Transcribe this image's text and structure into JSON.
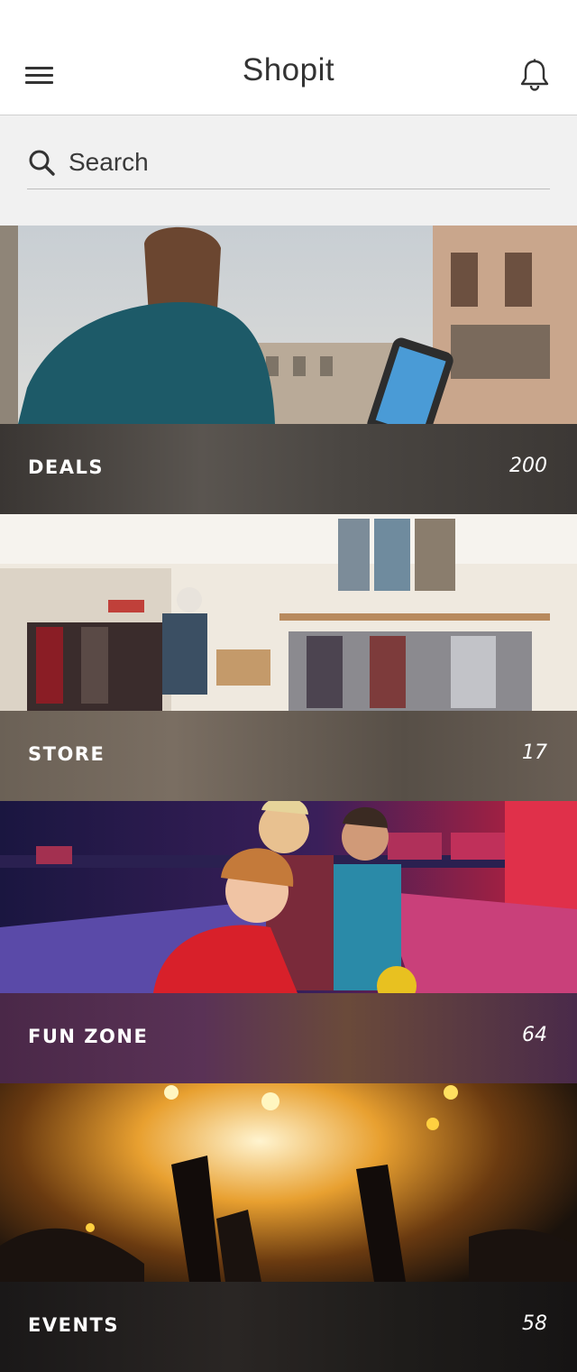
{
  "header": {
    "title": "Shopit",
    "menu_icon": "hamburger-menu-icon",
    "notification_icon": "bell-icon"
  },
  "search": {
    "placeholder": "Search",
    "value": "",
    "icon": "search-icon"
  },
  "categories": [
    {
      "label": "DEALS",
      "count": "200",
      "image": "woman-with-smartphone-city-photo"
    },
    {
      "label": "STORE",
      "count": "17",
      "image": "clothing-store-interior-photo"
    },
    {
      "label": "FUN ZONE",
      "count": "64",
      "image": "kids-at-bowling-alley-photo"
    },
    {
      "label": "EVENTS",
      "count": "58",
      "image": "concert-crowd-lights-photo"
    }
  ],
  "colors": {
    "header_bg": "#ffffff",
    "search_bg": "#f1f1f1",
    "text_dark": "#333333",
    "label_text": "#ffffff"
  }
}
